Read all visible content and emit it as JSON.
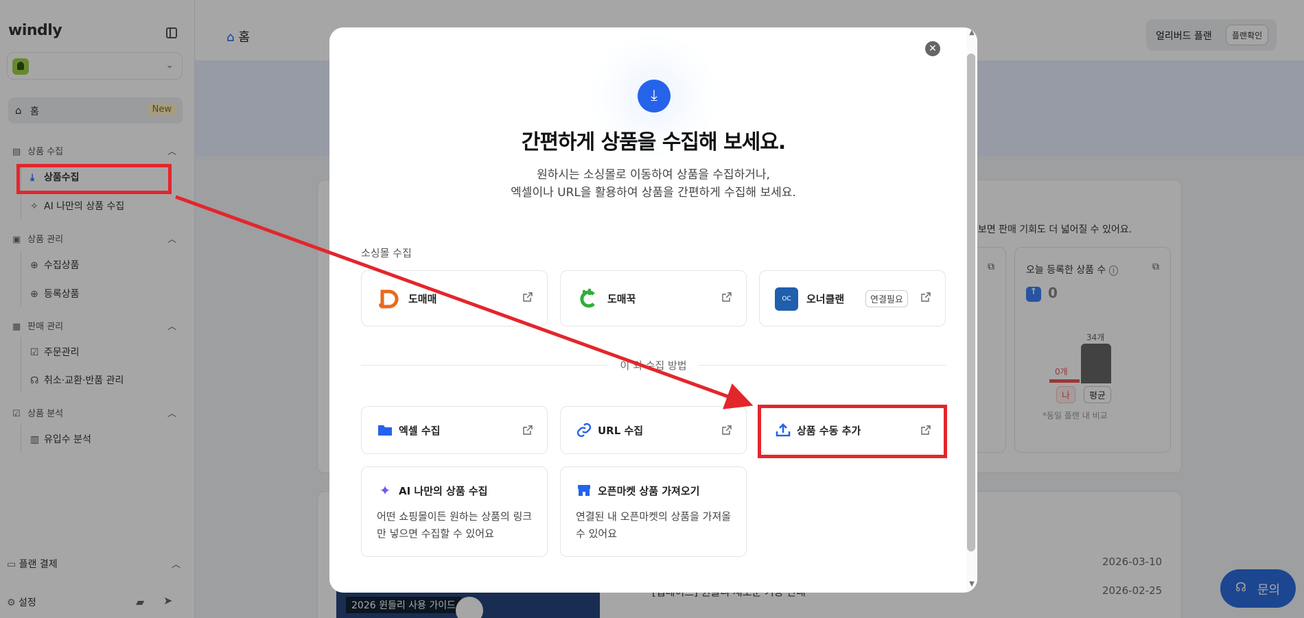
{
  "sidebar": {
    "logo": "windly",
    "home": {
      "label": "홈",
      "badge": "New"
    },
    "sections": [
      {
        "title": "상품 수집",
        "items": [
          "상품수집",
          "AI 나만의 상품 수집"
        ]
      },
      {
        "title": "상품 관리",
        "items": [
          "수집상품",
          "등록상품"
        ]
      },
      {
        "title": "판매 관리",
        "items": [
          "주문관리",
          "취소·교환·반품 관리"
        ]
      },
      {
        "title": "상품 분석",
        "items": [
          "유입수 분석"
        ]
      }
    ],
    "plan_payment": "플랜 결제",
    "settings": "설정"
  },
  "topbar": {
    "title": "홈",
    "plan_label": "얼리버드 플랜",
    "plan_button": "플랜확인"
  },
  "background": {
    "hint": "해보면 판매 기회도 더 넓어질 수 있어요.",
    "today_title": "오늘 등록한 상품 수",
    "today_count": "0",
    "bar_avg_value": "34개",
    "bar_me_value": "0개",
    "pill_me": "나",
    "pill_avg": "평균",
    "compare_note": "*동일 플랜 내 비교",
    "dates": [
      "2026-03-10",
      "2026-02-25"
    ],
    "notice": "[업데이트] 윈들리 새로운 기능 안내",
    "video_caption": "2026 윈들리 사용 가이드",
    "chat_label": "문의"
  },
  "modal": {
    "title": "간편하게 상품을 수집해 보세요.",
    "desc_line1": "원하시는 소싱몰로 이동하여 상품을 수집하거나,",
    "desc_line2": "엑셀이나 URL을 활용하여 상품을 간편하게 수집해 보세요.",
    "sourcing_label": "소싱몰 수집",
    "sourcing": [
      {
        "name": "도매매",
        "icon": "domeme-logo"
      },
      {
        "name": "도매꾹",
        "icon": "domeggook-logo"
      },
      {
        "name": "오너클랜",
        "icon": "ownerclan-logo",
        "tag": "연결필요"
      }
    ],
    "other_label": "이 외 수집 방법",
    "methods": [
      {
        "name": "엑셀 수집",
        "icon": "folder-icon"
      },
      {
        "name": "URL 수집",
        "icon": "link-icon"
      },
      {
        "name": "상품 수동 추가",
        "icon": "upload-icon"
      }
    ],
    "extended": [
      {
        "name": "AI 나만의 상품 수집",
        "desc": "어떤 쇼핑몰이든 원하는 상품의 링크만 넣으면 수집할 수 있어요",
        "icon": "sparkle-icon"
      },
      {
        "name": "오픈마켓 상품 가져오기",
        "desc": "연결된 내 오픈마켓의 상품을 가져올 수 있어요",
        "icon": "store-icon"
      }
    ]
  },
  "colors": {
    "accent": "#2563eb",
    "annotation_red": "#e3262b"
  }
}
